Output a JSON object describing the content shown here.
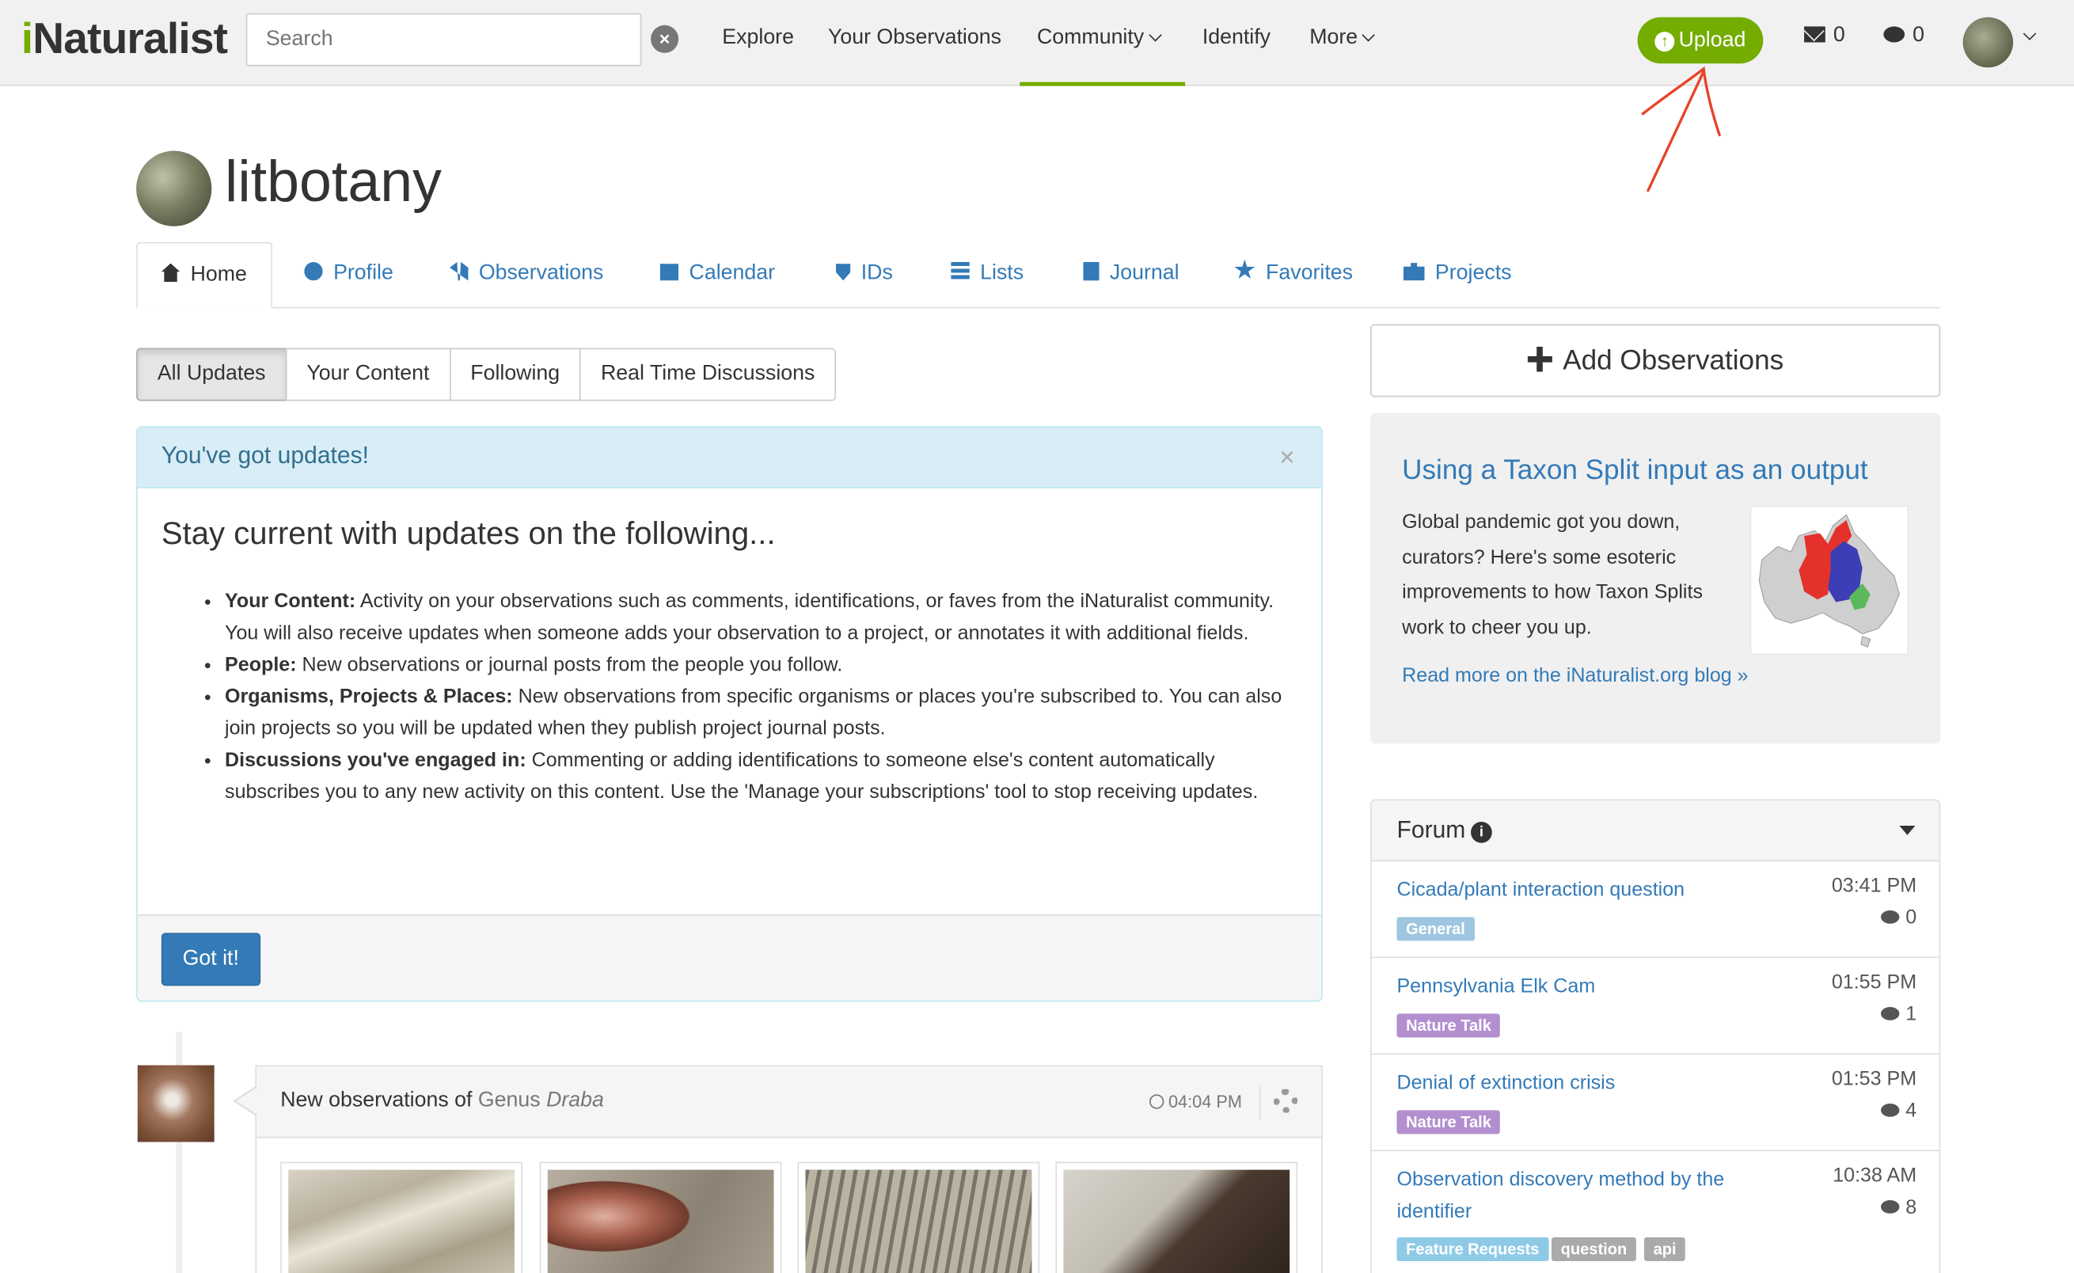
{
  "header": {
    "logo_i": "i",
    "logo_rest": "Naturalist",
    "search_placeholder": "Search",
    "nav": {
      "explore": "Explore",
      "your_observations": "Your Observations",
      "community": "Community",
      "identify": "Identify",
      "more": "More"
    },
    "upload_label": "Upload",
    "messages_count": "0",
    "notifications_count": "0"
  },
  "profile": {
    "username": "litbotany"
  },
  "tabs": [
    {
      "label": "Home",
      "icon": "home-icon"
    },
    {
      "label": "Profile",
      "icon": "user-icon"
    },
    {
      "label": "Observations",
      "icon": "binoculars-icon"
    },
    {
      "label": "Calendar",
      "icon": "calendar-icon"
    },
    {
      "label": "IDs",
      "icon": "shield-icon"
    },
    {
      "label": "Lists",
      "icon": "list-icon"
    },
    {
      "label": "Journal",
      "icon": "book-icon"
    },
    {
      "label": "Favorites",
      "icon": "star-icon"
    },
    {
      "label": "Projects",
      "icon": "briefcase-icon"
    }
  ],
  "filters": [
    "All Updates",
    "Your Content",
    "Following",
    "Real Time Discussions"
  ],
  "updates_panel": {
    "heading": "You've got updates!",
    "close": "×",
    "title": "Stay current with updates on the following...",
    "items": [
      {
        "label": "Your Content:",
        "text": " Activity on your observations such as comments, identifications, or faves from the iNaturalist community. You will also receive updates when someone adds your observation to a project, or annotates it with additional fields."
      },
      {
        "label": "People:",
        "text": " New observations or journal posts from the people you follow."
      },
      {
        "label": "Organisms, Projects & Places:",
        "text": " New observations from specific organisms or places you're subscribed to. You can also join projects so you will be updated when they publish project journal posts."
      },
      {
        "label": "Discussions you've engaged in:",
        "text": " Commenting or adding identifications to someone else's content automatically subscribes you to any new activity on this content. Use the 'Manage your subscriptions' tool to stop receiving updates."
      }
    ],
    "button": "Got it!"
  },
  "feed": {
    "prefix": "New observations of ",
    "rank": "Genus",
    "taxon": "Draba",
    "time": "04:04 PM"
  },
  "sidebar": {
    "add_observations": "Add Observations",
    "blog": {
      "title": "Using a Taxon Split input as an output",
      "text": "Global pandemic got you down, curators? Here's some esoteric improvements to how Taxon Splits work to cheer you up.",
      "link": "Read more on the iNaturalist.org blog »"
    },
    "forum": {
      "heading": "Forum",
      "topics": [
        {
          "title": "Cicada/plant interaction question",
          "time": "03:41 PM",
          "replies": "0",
          "tags": [
            {
              "label": "General",
              "color": "#9fc6e0"
            }
          ]
        },
        {
          "title": "Pennsylvania Elk Cam",
          "time": "01:55 PM",
          "replies": "1",
          "tags": [
            {
              "label": "Nature Talk",
              "color": "#b38fd0"
            }
          ]
        },
        {
          "title": "Denial of extinction crisis",
          "time": "01:53 PM",
          "replies": "4",
          "tags": [
            {
              "label": "Nature Talk",
              "color": "#b38fd0"
            }
          ]
        },
        {
          "title": "Observation discovery method by the identifier",
          "time": "10:38 AM",
          "replies": "8",
          "tags": [
            {
              "label": "Feature Requests",
              "color": "#8ecae6"
            },
            {
              "label": "question",
              "color": "#aaaaaa"
            },
            {
              "label": "api",
              "color": "#aaaaaa"
            }
          ]
        }
      ]
    }
  },
  "colors": {
    "brand_green": "#74ac00",
    "link_blue": "#337ab7",
    "annotation_red": "#e8432a"
  }
}
